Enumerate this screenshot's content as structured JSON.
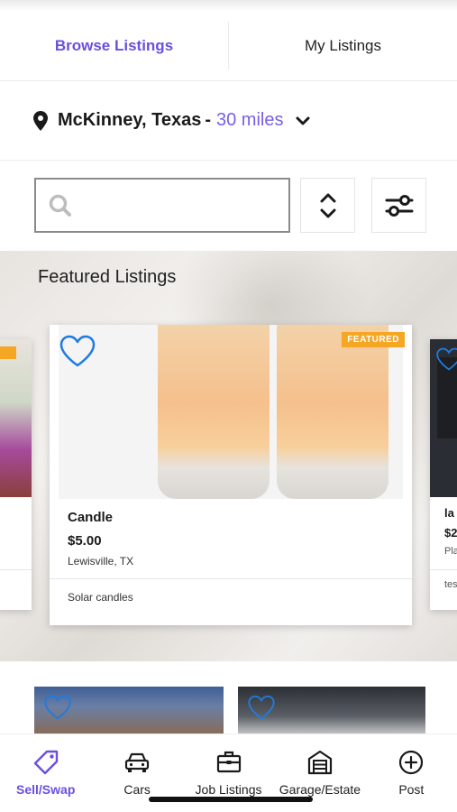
{
  "tabs": [
    {
      "label": "Browse Listings",
      "active": true
    },
    {
      "label": "My Listings",
      "active": false
    }
  ],
  "location": {
    "city": "McKinney, Texas",
    "separator": "-",
    "radius": "30 miles",
    "icon": "map-pin-icon",
    "dropdown_icon": "chevron-down-icon"
  },
  "search": {
    "placeholder": "",
    "value": "",
    "icon": "search-icon"
  },
  "controls": {
    "sort_icon": "sort-up-down-icon",
    "filter_icon": "sliders-icon"
  },
  "featured": {
    "title": "Featured Listings",
    "main_card": {
      "badge": "FEATURED",
      "title": "Candle",
      "price": "$5.00",
      "location": "Lewisville, TX",
      "description": "Solar candles"
    },
    "right_card_partial": {
      "title": "la",
      "price": "$2",
      "location": "Pla",
      "description": "tes"
    }
  },
  "bottom_nav": [
    {
      "label": "Sell/Swap",
      "icon": "tag-icon",
      "active": true
    },
    {
      "label": "Cars",
      "icon": "car-icon",
      "active": false
    },
    {
      "label": "Job Listings",
      "icon": "briefcase-icon",
      "active": false
    },
    {
      "label": "Garage/Estate",
      "icon": "garage-icon",
      "active": false
    },
    {
      "label": "Post",
      "icon": "plus-circle-icon",
      "active": false
    }
  ],
  "colors": {
    "accent": "#6b4fe0",
    "badge": "#f5a623",
    "heart": "#1e7be0"
  }
}
